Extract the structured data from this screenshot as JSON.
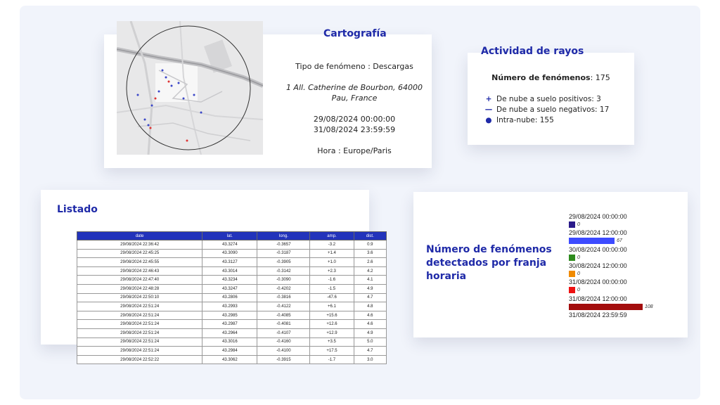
{
  "cartografia": {
    "title": "Cartografía",
    "tipo": "Tipo de fenómeno : Descargas",
    "address_line1": "1 All. Catherine de Bourbon, 64000",
    "address_line2": "Pau, France",
    "date_start": "29/08/2024 00:00:00",
    "date_end": "31/08/2024 23:59:59",
    "hora": "Hora : Europe/Paris"
  },
  "actividad": {
    "title": "Actividad de rayos",
    "count_label": "Número de fenómenos",
    "count_value": ": 175",
    "legend": [
      {
        "symbol": "+",
        "icon": "plus-icon",
        "label": "De nube a suelo positivos: 3"
      },
      {
        "symbol": "—",
        "icon": "minus-icon",
        "label": "De nube a suelo negativos: 17"
      },
      {
        "symbol": "●",
        "icon": "dot-icon",
        "label": "Intra-nube: 155"
      }
    ],
    "accent_color": "#1f2aa8"
  },
  "listado": {
    "title": "Listado",
    "columns": [
      "date",
      "lat.",
      "long.",
      "amp.",
      "dist."
    ],
    "rows": [
      [
        "29/08/2024 22:36:42",
        "43.3274",
        "-0.3657",
        "-3.2",
        "0.9"
      ],
      [
        "29/08/2024 22:45:25",
        "43.3090",
        "-0.3187",
        "+1.4",
        "3.6"
      ],
      [
        "29/08/2024 22:45:55",
        "43.3127",
        "-0.3905",
        "+1.0",
        "2.6"
      ],
      [
        "29/08/2024 22:46:43",
        "43.3014",
        "-0.3142",
        "+2.3",
        "4.2"
      ],
      [
        "29/08/2024 22:47:40",
        "43.3234",
        "-0.3090",
        "-1.6",
        "4.1"
      ],
      [
        "29/08/2024 22:48:28",
        "43.3247",
        "-0.4202",
        "-1.5",
        "4.9"
      ],
      [
        "29/08/2024 22:50:10",
        "43.2806",
        "-0.3816",
        "-47.6",
        "4.7"
      ],
      [
        "29/08/2024 22:51:24",
        "43.2993",
        "-0.4122",
        "+6.1",
        "4.8"
      ],
      [
        "29/08/2024 22:51:24",
        "43.2985",
        "-0.4085",
        "+15.6",
        "4.6"
      ],
      [
        "29/08/2024 22:51:24",
        "43.2987",
        "-0.4081",
        "+12.6",
        "4.6"
      ],
      [
        "29/08/2024 22:51:24",
        "43.2964",
        "-0.4107",
        "+12.9",
        "4.9"
      ],
      [
        "29/08/2024 22:51:24",
        "43.3016",
        "-0.4160",
        "+3.5",
        "5.0"
      ],
      [
        "29/08/2024 22:51:24",
        "43.2984",
        "-0.4100",
        "+17.5",
        "4.7"
      ],
      [
        "29/08/2024 22:52:22",
        "43.3062",
        "-0.3915",
        "-1.7",
        "3.0"
      ]
    ],
    "header_color": "#2233bb"
  },
  "franja": {
    "title": "Número de fenómenos detectados por franja horaria",
    "labels": [
      "29/08/2024 00:00:00",
      "29/08/2024 12:00:00",
      "30/08/2024 00:00:00",
      "30/08/2024 12:00:00",
      "31/08/2024 00:00:00",
      "31/08/2024 12:00:00",
      "31/08/2024 23:59:59"
    ],
    "bar_values": [
      "0",
      "67",
      "0",
      "0",
      "0",
      "108"
    ]
  },
  "chart_data": {
    "type": "bar",
    "title": "Número de fenómenos detectados por franja horaria",
    "categories": [
      "29/08/2024 00:00:00",
      "29/08/2024 12:00:00",
      "30/08/2024 00:00:00",
      "30/08/2024 12:00:00",
      "31/08/2024 00:00:00",
      "31/08/2024 12:00:00"
    ],
    "values": [
      0,
      67,
      0,
      0,
      0,
      108
    ],
    "colors": [
      "#2a1a8a",
      "#3d4bff",
      "#2e8b1e",
      "#f08a00",
      "#ee1111",
      "#a30d0d"
    ],
    "orientation": "horizontal",
    "xlim": [
      0,
      108
    ]
  }
}
